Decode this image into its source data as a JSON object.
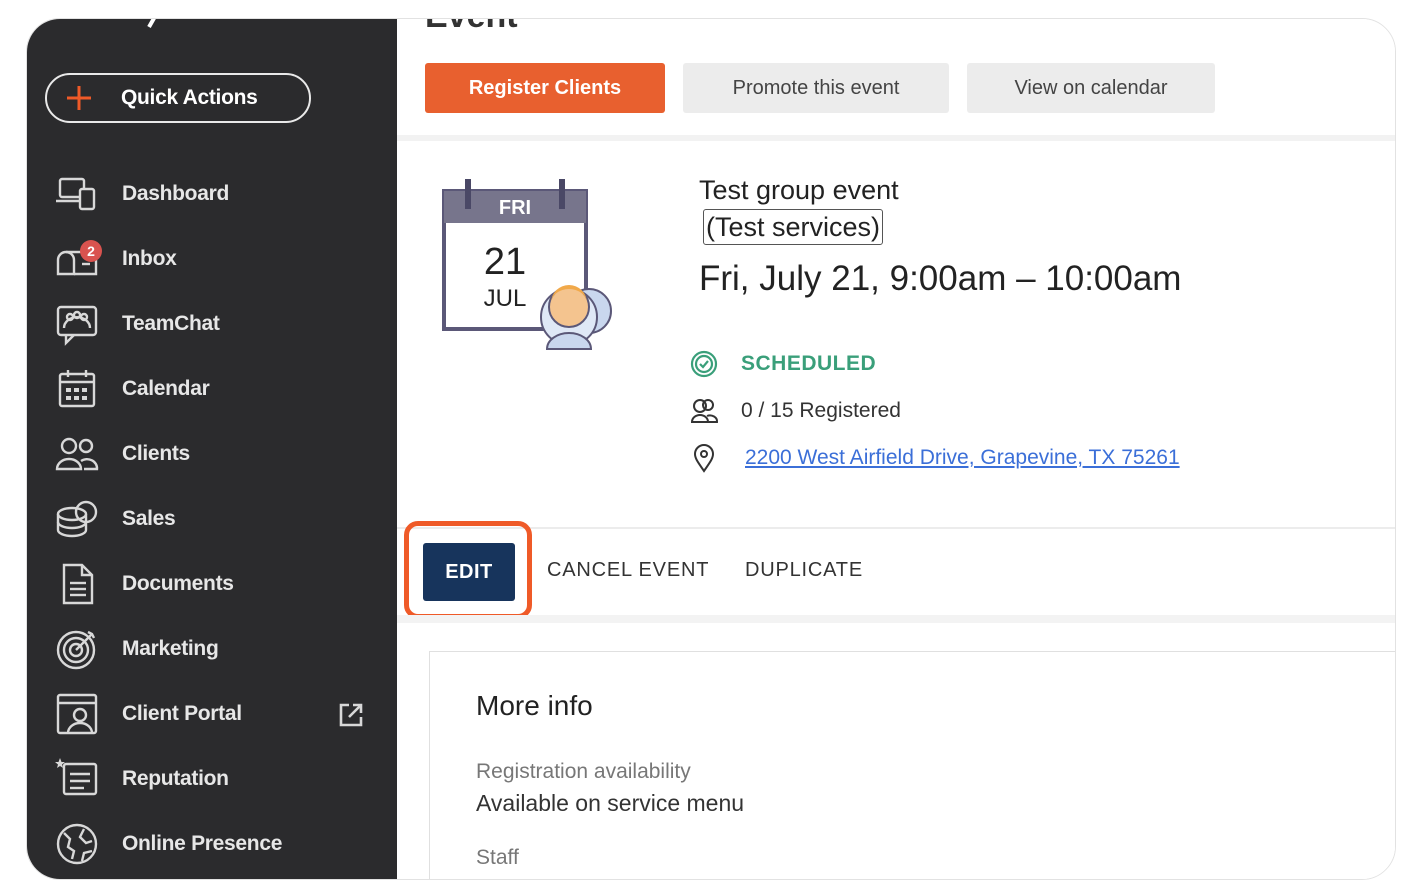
{
  "sidebar": {
    "quick_actions_label": "Quick Actions",
    "items": [
      {
        "label": "Dashboard",
        "icon": "dashboard-icon"
      },
      {
        "label": "Inbox",
        "icon": "inbox-icon",
        "badge": "2"
      },
      {
        "label": "TeamChat",
        "icon": "teamchat-icon"
      },
      {
        "label": "Calendar",
        "icon": "calendar-icon"
      },
      {
        "label": "Clients",
        "icon": "clients-icon"
      },
      {
        "label": "Sales",
        "icon": "sales-icon"
      },
      {
        "label": "Documents",
        "icon": "documents-icon"
      },
      {
        "label": "Marketing",
        "icon": "marketing-icon"
      },
      {
        "label": "Client Portal",
        "icon": "client-portal-icon"
      },
      {
        "label": "Reputation",
        "icon": "reputation-icon"
      },
      {
        "label": "Online Presence",
        "icon": "online-presence-icon"
      }
    ]
  },
  "page": {
    "title": "Event"
  },
  "header_buttons": {
    "register": "Register Clients",
    "promote": "Promote this event",
    "view_calendar": "View on calendar"
  },
  "event": {
    "day_of_week": "FRI",
    "day": "21",
    "month": "JUL",
    "name": "Test group event",
    "service": "(Test services)",
    "time": "Fri, July 21, 9:00am – 10:00am",
    "status": "SCHEDULED",
    "registered": "0 / 15 Registered",
    "address": "2200 West Airfield Drive, Grapevine, TX 75261"
  },
  "actions": {
    "edit": "EDIT",
    "cancel": "CANCEL EVENT",
    "duplicate": "DUPLICATE"
  },
  "more_info": {
    "title": "More info",
    "registration_label": "Registration availability",
    "registration_value": "Available on service menu",
    "staff_label": "Staff"
  },
  "colors": {
    "sidebar_bg": "#2b2b2d",
    "accent_orange": "#e8602f",
    "edit_navy": "#17345c",
    "status_green": "#3a9f7a",
    "link_blue": "#3b6fd8"
  }
}
